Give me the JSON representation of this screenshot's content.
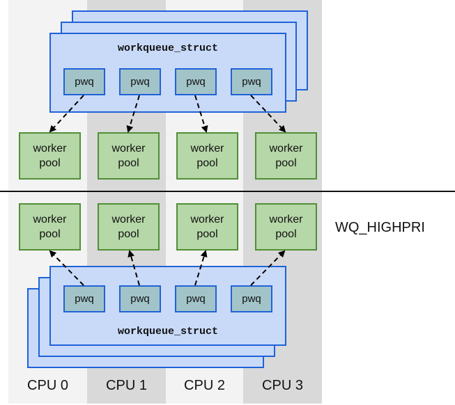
{
  "columns": [
    {
      "label": "CPU 0",
      "shade": "light"
    },
    {
      "label": "CPU 1",
      "shade": "dark"
    },
    {
      "label": "CPU 2",
      "shade": "light"
    },
    {
      "label": "CPU 3",
      "shade": "dark"
    }
  ],
  "top_section": {
    "workqueue_label": "workqueue_struct",
    "pwq_label": "pwq",
    "pool_line1": "worker",
    "pool_line2": "pool",
    "arrow_direction": "pwq-to-pool"
  },
  "bottom_section": {
    "workqueue_label": "workqueue_struct",
    "pwq_label": "pwq",
    "pool_line1": "worker",
    "pool_line2": "pool",
    "arrow_direction": "pwq-to-pool",
    "side_label": "WQ_HIGHPRI"
  },
  "colors": {
    "workqueue_fill": "#c9daf8",
    "workqueue_border": "#1f62d9",
    "pwq_fill": "#a2c4c9",
    "pool_fill": "#b6d7a8",
    "pool_border": "#4f8f35",
    "col_light": "#f3f3f3",
    "col_dark": "#d9d9d9"
  }
}
